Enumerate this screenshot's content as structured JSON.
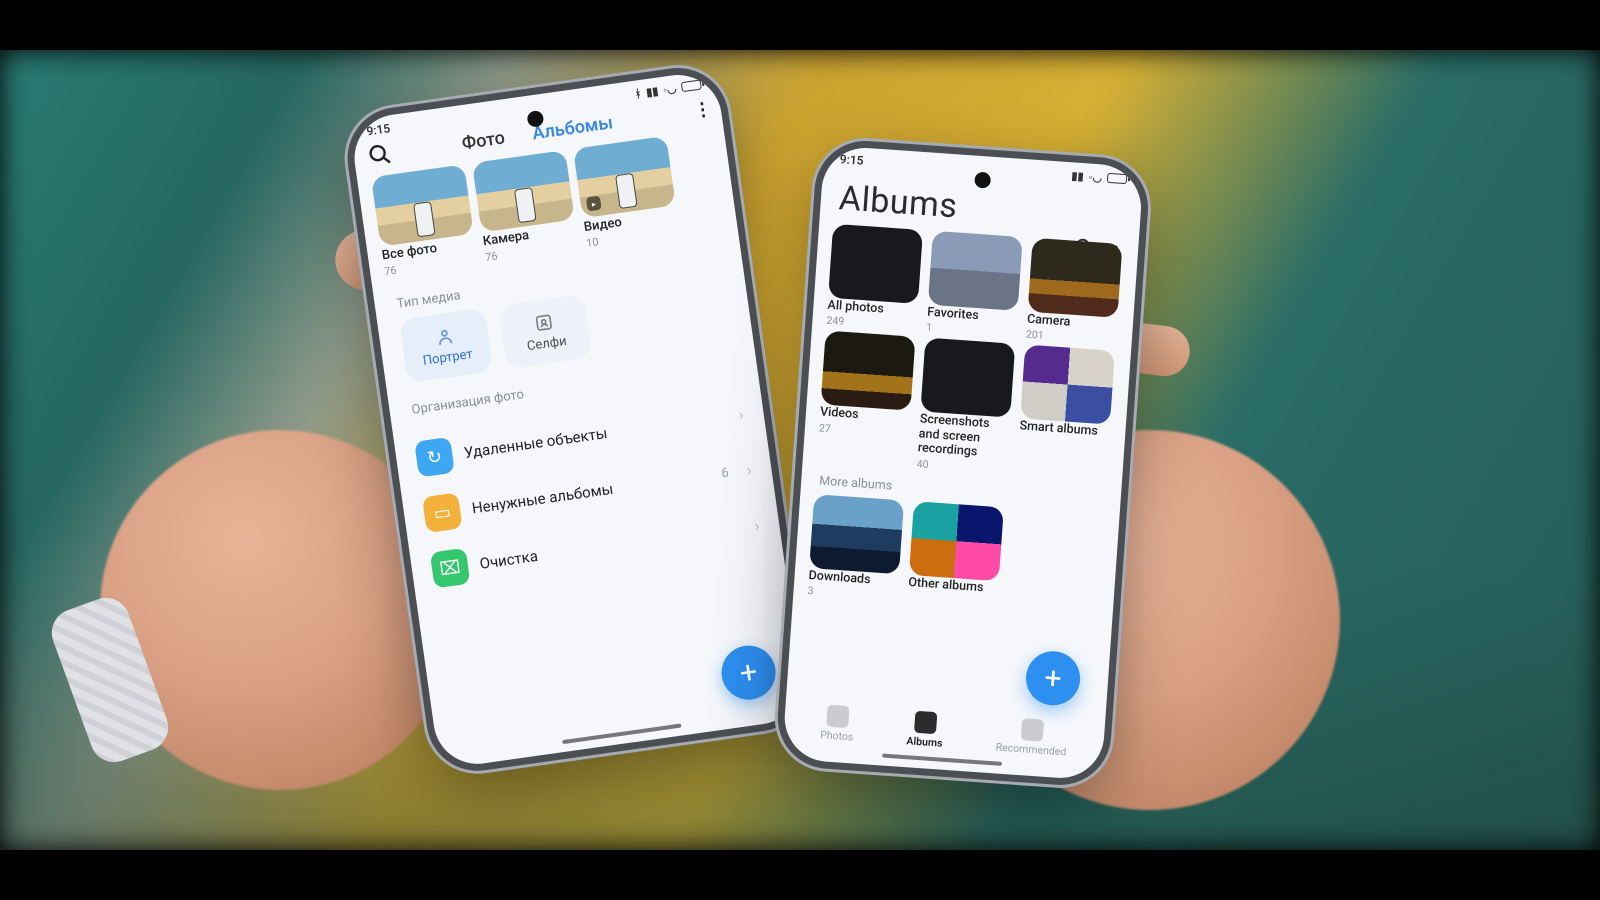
{
  "phone_left": {
    "status_time": "9:15",
    "tabs": {
      "photos": "Фото",
      "albums": "Альбомы"
    },
    "albums": [
      {
        "label": "Все фото",
        "count": "76"
      },
      {
        "label": "Камера",
        "count": "76"
      },
      {
        "label": "Видео",
        "count": "10"
      }
    ],
    "media_type_header": "Тип медиа",
    "chips": {
      "portrait": "Портрет",
      "selfie": "Селфи"
    },
    "organize_header": "Организация фото",
    "org": {
      "deleted": {
        "label": "Удаленные объекты"
      },
      "unneeded": {
        "label": "Ненужные альбомы",
        "count": "6"
      },
      "cleanup": {
        "label": "Очистка"
      }
    }
  },
  "phone_right": {
    "status_time": "9:15",
    "title": "Albums",
    "albums": [
      {
        "label": "All photos",
        "count": "249"
      },
      {
        "label": "Favorites",
        "count": "1"
      },
      {
        "label": "Camera",
        "count": "201"
      },
      {
        "label": "Videos",
        "count": "27"
      },
      {
        "label": "Screenshots and screen recordings",
        "count": "40"
      },
      {
        "label": "Smart albums",
        "count": ""
      }
    ],
    "more_header": "More albums",
    "more": [
      {
        "label": "Downloads",
        "count": "3"
      },
      {
        "label": "Other albums",
        "count": ""
      }
    ],
    "bottom": {
      "photos": "Photos",
      "albums": "Albums",
      "recommended": "Recommended"
    }
  }
}
